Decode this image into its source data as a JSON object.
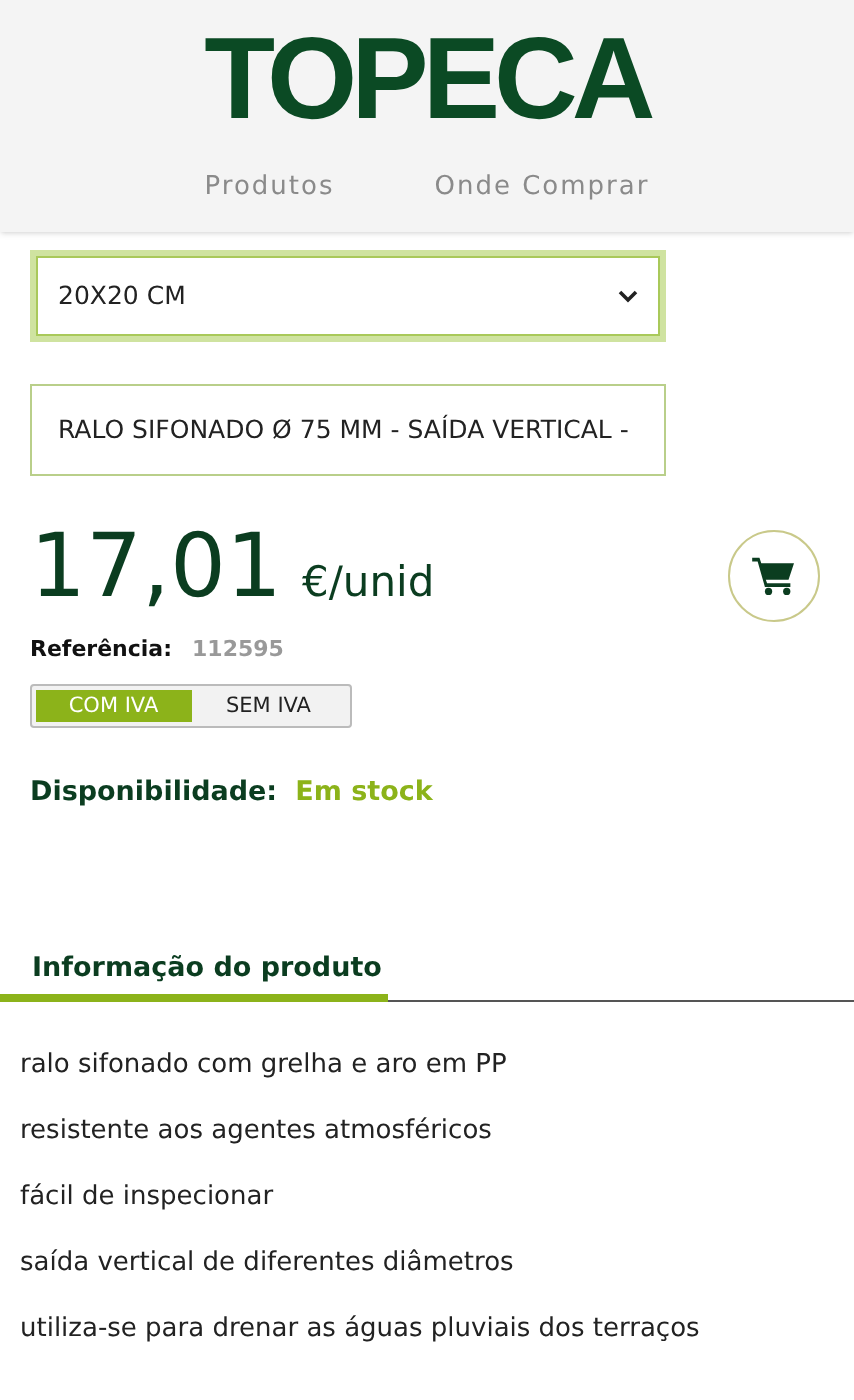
{
  "header": {
    "logo": "TOPECA",
    "nav": [
      "Produtos",
      "Onde Comprar"
    ]
  },
  "selects": [
    {
      "value": "20X20 CM",
      "focused": true,
      "has_caret": true
    },
    {
      "value": "RALO SIFONADO Ø 75 MM - SAÍDA VERTICAL -",
      "focused": false,
      "has_caret": false
    }
  ],
  "price": {
    "amount": "17,01",
    "unit": "€/unid"
  },
  "reference": {
    "label": "Referência:",
    "value": "112595"
  },
  "tax_toggle": [
    {
      "label": "COM IVA",
      "selected": true
    },
    {
      "label": "SEM IVA",
      "selected": false
    }
  ],
  "availability": {
    "label": "Disponibilidade:",
    "value": "Em stock"
  },
  "info_tab": {
    "label": "Informação do produto"
  },
  "features": [
    "ralo sifonado com grelha e aro em PP",
    "resistente aos agentes atmosféricos",
    "fácil de inspecionar",
    "saída vertical de diferentes diâmetros",
    "utiliza-se para drenar as águas pluviais dos terraços"
  ]
}
